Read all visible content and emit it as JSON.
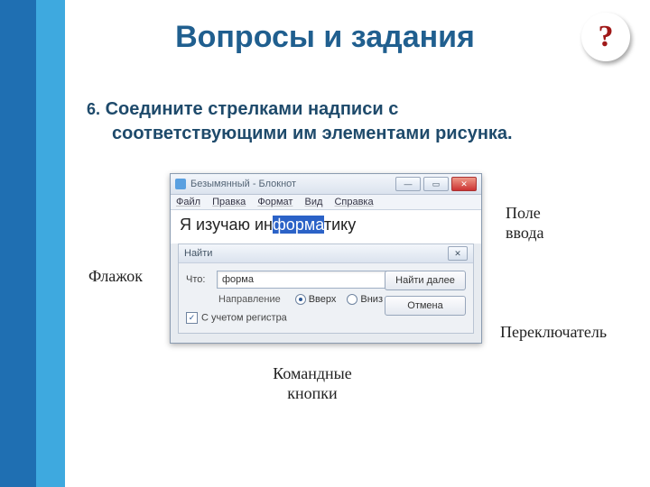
{
  "page": {
    "title": "Вопросы и задания",
    "help_symbol": "?"
  },
  "task": {
    "number": "6.",
    "line1": "Соедините стрелками надписи с",
    "line2": "соответствующими им элементами рисунка."
  },
  "labels": {
    "flag": "Флажок",
    "input_field_l1": "Поле",
    "input_field_l2": "ввода",
    "switch": "Переключатель",
    "cmd_l1": "Командные",
    "cmd_l2": "кнопки"
  },
  "notepad": {
    "title": "Безымянный - Блокнот",
    "menu": {
      "file": "Файл",
      "edit": "Правка",
      "format": "Формат",
      "view": "Вид",
      "help": "Справка"
    },
    "text_before": "Я изучаю ин",
    "text_sel": "форма",
    "text_after": "тику"
  },
  "find": {
    "title": "Найти",
    "what_label": "Что:",
    "what_value": "форма",
    "direction_label": "Направление",
    "radio_up": "Вверх",
    "radio_down": "Вниз",
    "case_label": "С учетом регистра",
    "find_next": "Найти далее",
    "cancel": "Отмена"
  }
}
